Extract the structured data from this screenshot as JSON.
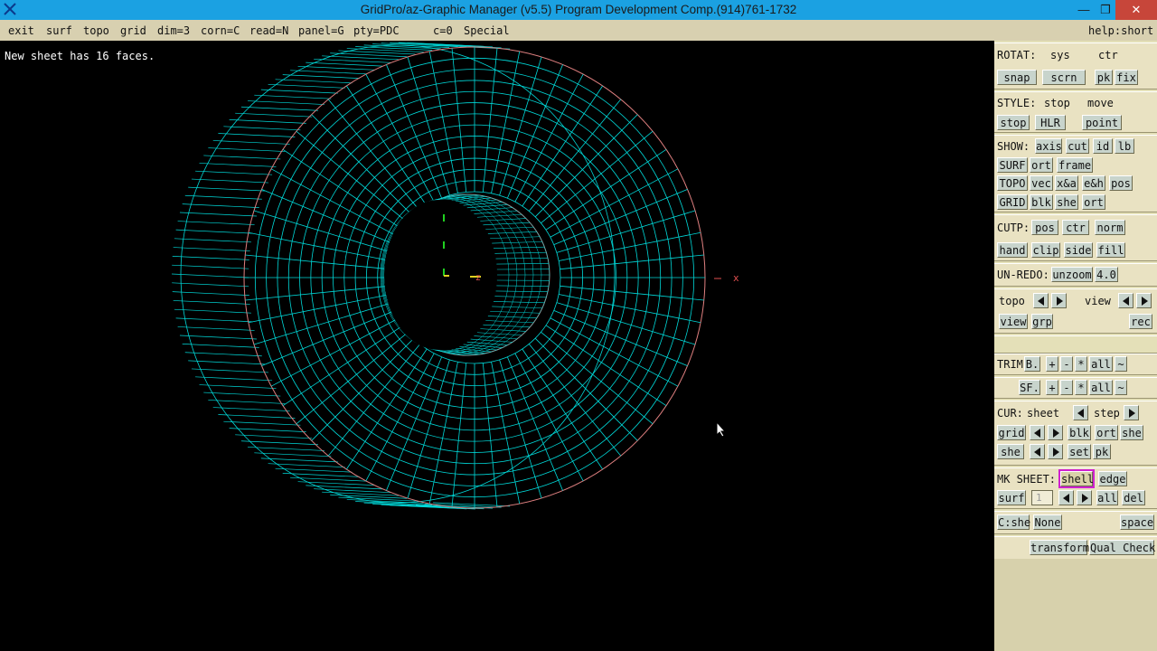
{
  "window": {
    "title": "GridPro/az-Graphic Manager (v5.5)    Program Development Comp.(914)761-1732",
    "minimize": "—",
    "restore": "❐",
    "close": "✕"
  },
  "menu": {
    "items": [
      "exit",
      "surf",
      "topo",
      "grid",
      "dim=3",
      "corn=C",
      "read=N",
      "panel=G",
      "pty=PDC",
      "c=0",
      "Special"
    ],
    "help": "help:short"
  },
  "viewport": {
    "message": "New sheet has 16 faces.",
    "axis_z": "z",
    "axis_x": "x"
  },
  "panel": {
    "rotat": {
      "label": "ROTAT:",
      "sys": "sys",
      "ctr": "ctr",
      "buttons": [
        "snap",
        "scrn",
        "pk",
        "fix"
      ]
    },
    "style": {
      "label": "STYLE:",
      "stop_text": "stop",
      "move_text": "move",
      "buttons": [
        "stop",
        "HLR",
        "point"
      ]
    },
    "show": {
      "label": "SHOW:",
      "row1": [
        "axis",
        "cut",
        "id",
        "lb"
      ],
      "row2": [
        "SURF",
        "ort",
        "frame"
      ],
      "row3": [
        "TOPO",
        "vec",
        "x&a",
        "e&h",
        "pos"
      ],
      "row4": [
        "GRID",
        "blk",
        "she",
        "ort"
      ]
    },
    "cutp": {
      "label": "CUTP:",
      "row1": [
        "pos",
        "ctr",
        "norm"
      ],
      "row2": [
        "hand",
        "clip",
        "side",
        "fill"
      ]
    },
    "unredo": {
      "label": "UN-REDO:",
      "unzoom": "unzoom",
      "value": "4.0"
    },
    "topo_view": {
      "topo": "topo",
      "view": "view",
      "view_btn": "view",
      "grp": "grp",
      "rec": "rec"
    },
    "trim": {
      "label": "TRIM",
      "row1": [
        "B.",
        "+",
        "-",
        "*",
        "all",
        "~"
      ],
      "row2": [
        "SF.",
        "+",
        "-",
        "*",
        "all",
        "~"
      ]
    },
    "cur": {
      "label": "CUR:",
      "sheet": "sheet",
      "step": "step",
      "row2": [
        "grid",
        "blk",
        "ort",
        "she"
      ],
      "row3_start": "she",
      "row3_end": [
        "set",
        "pk"
      ]
    },
    "mksheet": {
      "label": "MK SHEET:",
      "shell": "shell",
      "edge": "edge",
      "surf": "surf",
      "field_value": "1",
      "all": "all",
      "del": "del"
    },
    "cshe": {
      "cshe": "C:she",
      "none": "None",
      "space": "space"
    },
    "bottom": {
      "transform": "transform",
      "qual": "Qual Check"
    }
  },
  "colors": {
    "title_bar": "#1ba1e2",
    "menu_bg": "#d8d0b0",
    "panel_bg": "#e4e0b8",
    "button_bg": "#c8d4cc",
    "mesh_cyan": "#00d8d8",
    "mesh_outline": "#e08080",
    "highlight": "#d020d0"
  }
}
